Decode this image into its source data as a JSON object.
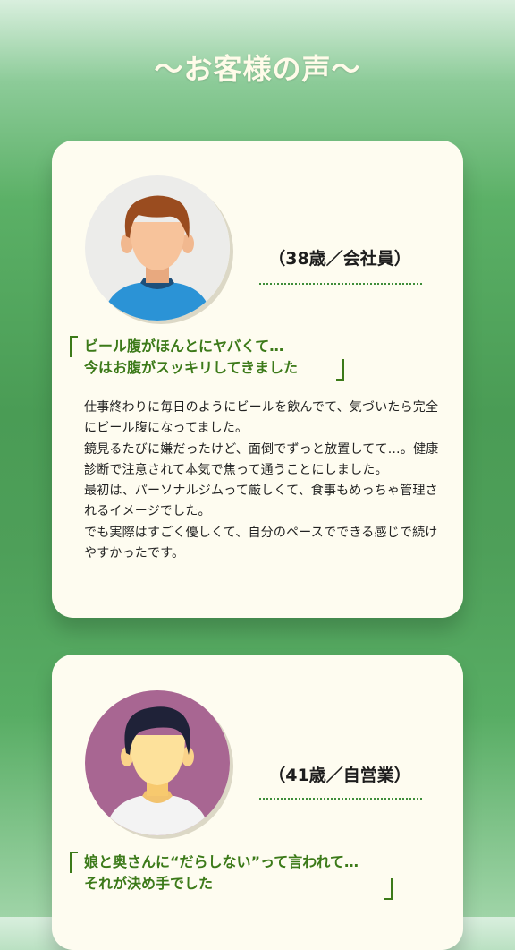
{
  "page": {
    "title": "〜お客様の声〜"
  },
  "testimonials": [
    {
      "meta": "（38歳／会社員）",
      "avatar_icon": "man-avatar-icon",
      "headline": [
        "ビール腹がほんとにヤバくて…",
        "今はお腹がスッキリしてきました"
      ],
      "body": [
        "仕事終わりに毎日のようにビールを飲んでて、気づいたら完全にビール腹になってました。",
        "鏡見るたびに嫌だったけど、面倒でずっと放置してて…。健康診断で注意されて本気で焦って通うことにしました。",
        "最初は、パーソナルジムって厳しくて、食事もめっちゃ管理されるイメージでした。",
        "でも実際はすごく優しくて、自分のペースでできる感じで続けやすかったです。"
      ]
    },
    {
      "meta": "（41歳／自営業）",
      "avatar_icon": "man-avatar-icon",
      "headline": [
        "娘と奥さんに“だらしない”って言われて…",
        "それが決め手でした"
      ]
    }
  ],
  "colors": {
    "accent": "#3c7a19",
    "card_bg": "#fefcf0",
    "title_text": "#fffbe9",
    "avatar1_bg": "#ececea",
    "avatar2_bg": "#a86692"
  }
}
